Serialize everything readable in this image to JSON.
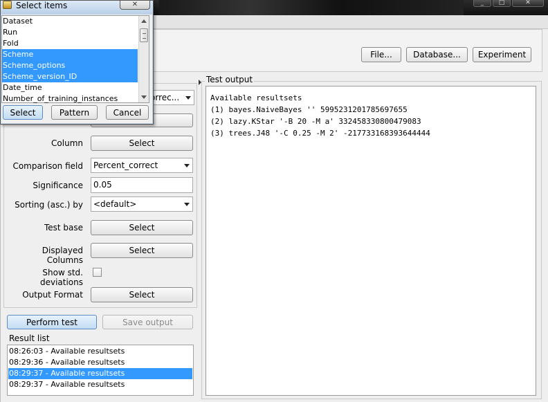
{
  "dialog": {
    "title": "Select items",
    "items": [
      {
        "label": "Dataset",
        "selected": false
      },
      {
        "label": "Run",
        "selected": false
      },
      {
        "label": "Fold",
        "selected": false
      },
      {
        "label": "Scheme",
        "selected": true
      },
      {
        "label": "Scheme_options",
        "selected": true
      },
      {
        "label": "Scheme_version_ID",
        "selected": true
      },
      {
        "label": "Date_time",
        "selected": false
      },
      {
        "label": "Number_of_training_instances",
        "selected": false
      }
    ],
    "buttons": {
      "select": "Select",
      "pattern": "Pattern",
      "cancel": "Cancel"
    }
  },
  "source": {
    "file_button": "File...",
    "database_button": "Database...",
    "experiment_button": "Experiment"
  },
  "test_panel": {
    "row_partial_combo": "orrec...",
    "column_label": "Column",
    "column_button": "Select",
    "comparison_label": "Comparison field",
    "comparison_value": "Percent_correct",
    "significance_label": "Significance",
    "significance_value": "0.05",
    "sorting_label": "Sorting (asc.) by",
    "sorting_value": "<default>",
    "test_base_label": "Test base",
    "test_base_button": "Select",
    "displayed_columns_label": "Displayed Columns",
    "displayed_columns_button": "Select",
    "show_std_label": "Show std. deviations",
    "output_format_label": "Output Format",
    "output_format_button": "Select"
  },
  "actions": {
    "perform_test": "Perform test",
    "save_output": "Save output"
  },
  "result_list": {
    "title": "Result list",
    "items": [
      {
        "label": "08:26:03 - Available resultsets",
        "selected": false
      },
      {
        "label": "08:29:36 - Available resultsets",
        "selected": false
      },
      {
        "label": "08:29:37 - Available resultsets",
        "selected": true
      },
      {
        "label": "08:29:37 - Available resultsets",
        "selected": false
      }
    ]
  },
  "test_output": {
    "title": "Test output",
    "lines": [
      "Available resultsets",
      "(1) bayes.NaiveBayes '' 5995231201785697655",
      "(2) lazy.KStar '-B 20 -M a' 332458330800479083",
      "(3) trees.J48 '-C 0.25 -M 2' -217733168393644444"
    ]
  }
}
